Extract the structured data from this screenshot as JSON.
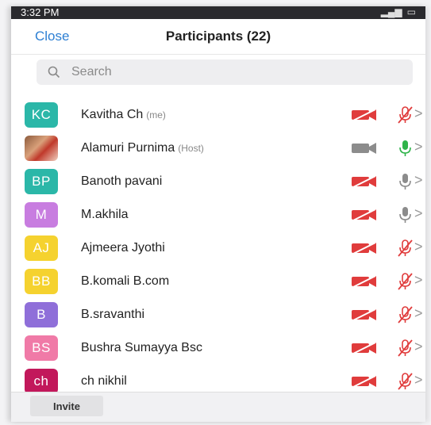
{
  "status_bar": {
    "time": "3:32 PM"
  },
  "header": {
    "close_label": "Close",
    "title": "Participants (22)"
  },
  "search": {
    "placeholder": "Search"
  },
  "participants": [
    {
      "initials": "KC",
      "name": "Kavitha Ch",
      "tag": "(me)",
      "color": "#2bb7a8",
      "video": "off",
      "mic": "muted"
    },
    {
      "initials": "",
      "name": "Alamuri Purnima",
      "tag": "(Host)",
      "color": "#a56b4a",
      "video": "on",
      "mic": "active"
    },
    {
      "initials": "BP",
      "name": "Banoth pavani",
      "tag": "",
      "color": "#2bb7a8",
      "video": "off",
      "mic": "on"
    },
    {
      "initials": "M",
      "name": "M.akhila",
      "tag": "",
      "color": "#c87de0",
      "video": "off",
      "mic": "on"
    },
    {
      "initials": "AJ",
      "name": "Ajmeera Jyothi",
      "tag": "",
      "color": "#f5d22f",
      "video": "off",
      "mic": "muted"
    },
    {
      "initials": "BB",
      "name": "B.komali B.com",
      "tag": "",
      "color": "#f5d22f",
      "video": "off",
      "mic": "muted"
    },
    {
      "initials": "B",
      "name": "B.sravanthi",
      "tag": "",
      "color": "#8f6fd9",
      "video": "off",
      "mic": "muted"
    },
    {
      "initials": "BS",
      "name": "Bushra Sumayya Bsc",
      "tag": "",
      "color": "#f07aa7",
      "video": "off",
      "mic": "muted"
    },
    {
      "initials": "ch",
      "name": "ch nikhil",
      "tag": "",
      "color": "#c2185b",
      "video": "off",
      "mic": "muted"
    }
  ],
  "footer": {
    "invite_label": "Invite"
  },
  "colors": {
    "muted_red": "#e03c3c",
    "mic_green": "#2fb34a",
    "icon_gray": "#8c8c8c",
    "accent_blue": "#2d7fd3"
  }
}
